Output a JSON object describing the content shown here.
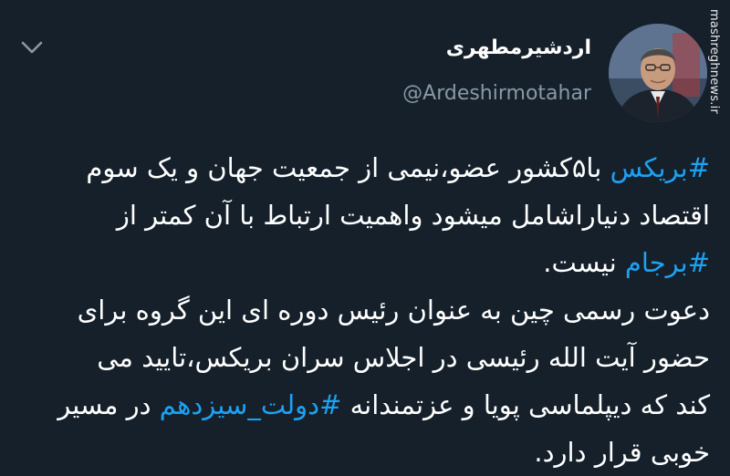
{
  "user": {
    "display_name": "اردشیرمطهری",
    "handle": "@Ardeshirmotahar"
  },
  "tweet": {
    "line1_hashtag": "#بریکس",
    "line1_text": " با۵کشور عضو،نیمی از جمعیت جهان و یک سوم",
    "line2_text": "اقتصاد دنیاراشامل میشود واهمیت ارتباط با آن کمتر از",
    "line3_hashtag": "#برجام",
    "line3_text": " نیست.",
    "line4_text": "دعوت رسمی چین به عنوان رئیس دوره ای این گروه برای",
    "line5_text": "حضور آیت الله رئیسی در اجلاس سران بریکس،تایید می",
    "line6_prefix": "کند که دیپلماسی پویا و عزتمندانه ",
    "line6_hashtag": "#دولت_سیزدهم",
    "line6_suffix": " در مسیر",
    "line7_text": "خوبی قرار دارد."
  },
  "watermark": {
    "text": "mashreghnews.ir"
  },
  "icons": {
    "menu": "chevron-down-icon",
    "avatar": "avatar-photo"
  },
  "colors": {
    "background": "#15202b",
    "text": "#ffffff",
    "secondary": "#8899a6",
    "link": "#1da1f2"
  }
}
